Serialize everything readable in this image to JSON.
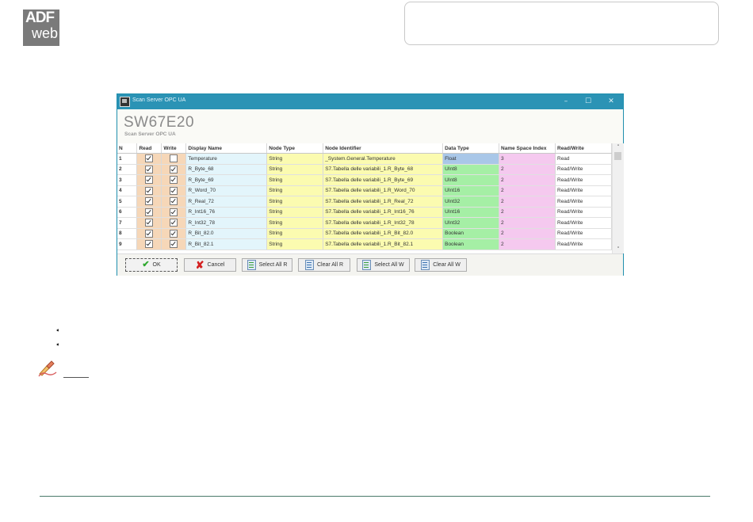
{
  "logo": {
    "line1": "ADF",
    "line2": "web"
  },
  "window": {
    "title": "Scan Server OPC UA",
    "controls": {
      "minimize": "–",
      "maximize": "☐",
      "close": "✕"
    },
    "heading": "SW67E20",
    "subheading": "Scan Server OPC UA"
  },
  "table": {
    "columns": [
      "N",
      "Read",
      "Write",
      "Display Name",
      "Node Type",
      "Node Identifier",
      "Data Type",
      "Name Space Index",
      "Read/Write"
    ],
    "rows": [
      {
        "n": "1",
        "read": true,
        "write": false,
        "display_name": "Temperature",
        "node_type": "String",
        "node_identifier": "_System.General.Temperature",
        "data_type": "Float",
        "ns_index": "3",
        "rw": "Read"
      },
      {
        "n": "2",
        "read": true,
        "write": true,
        "display_name": "R_Byte_68",
        "node_type": "String",
        "node_identifier": "S7.Tabella delle variabili_1.R_Byte_68",
        "data_type": "UInt8",
        "ns_index": "2",
        "rw": "Read/Write"
      },
      {
        "n": "3",
        "read": true,
        "write": true,
        "display_name": "R_Byte_69",
        "node_type": "String",
        "node_identifier": "S7.Tabella delle variabili_1.R_Byte_69",
        "data_type": "UInt8",
        "ns_index": "2",
        "rw": "Read/Write"
      },
      {
        "n": "4",
        "read": true,
        "write": true,
        "display_name": "R_Word_70",
        "node_type": "String",
        "node_identifier": "S7.Tabella delle variabili_1.R_Word_70",
        "data_type": "UInt16",
        "ns_index": "2",
        "rw": "Read/Write"
      },
      {
        "n": "5",
        "read": true,
        "write": true,
        "display_name": "R_Real_72",
        "node_type": "String",
        "node_identifier": "S7.Tabella delle variabili_1.R_Real_72",
        "data_type": "UInt32",
        "ns_index": "2",
        "rw": "Read/Write"
      },
      {
        "n": "6",
        "read": true,
        "write": true,
        "display_name": "R_Int16_76",
        "node_type": "String",
        "node_identifier": "S7.Tabella delle variabili_1.R_Int16_76",
        "data_type": "UInt16",
        "ns_index": "2",
        "rw": "Read/Write"
      },
      {
        "n": "7",
        "read": true,
        "write": true,
        "display_name": "R_Int32_78",
        "node_type": "String",
        "node_identifier": "S7.Tabella delle variabili_1.R_Int32_78",
        "data_type": "UInt32",
        "ns_index": "2",
        "rw": "Read/Write"
      },
      {
        "n": "8",
        "read": true,
        "write": true,
        "display_name": "R_Bit_82.0",
        "node_type": "String",
        "node_identifier": "S7.Tabella delle variabili_1.R_Bit_82.0",
        "data_type": "Boolean",
        "ns_index": "2",
        "rw": "Read/Write"
      },
      {
        "n": "9",
        "read": true,
        "write": true,
        "display_name": "R_Bit_82.1",
        "node_type": "String",
        "node_identifier": "S7.Tabella delle variabili_1.R_Bit_82.1",
        "data_type": "Boolean",
        "ns_index": "2",
        "rw": "Read/Write"
      }
    ]
  },
  "buttons": {
    "ok": "OK",
    "cancel": "Cancel",
    "select_all_r": "Select All R",
    "clear_all_r": "Clear All R",
    "select_all_w": "Select All W",
    "clear_all_w": "Clear All W"
  },
  "colors": {
    "titlebar": "#2b93b5",
    "read_write_cols": "#f6d7b8",
    "display_name_col": "#e3f5fb",
    "node_cols": "#fbfbb0",
    "data_type_col": "#a5efa5",
    "ns_index_col": "#f5c9ef"
  }
}
